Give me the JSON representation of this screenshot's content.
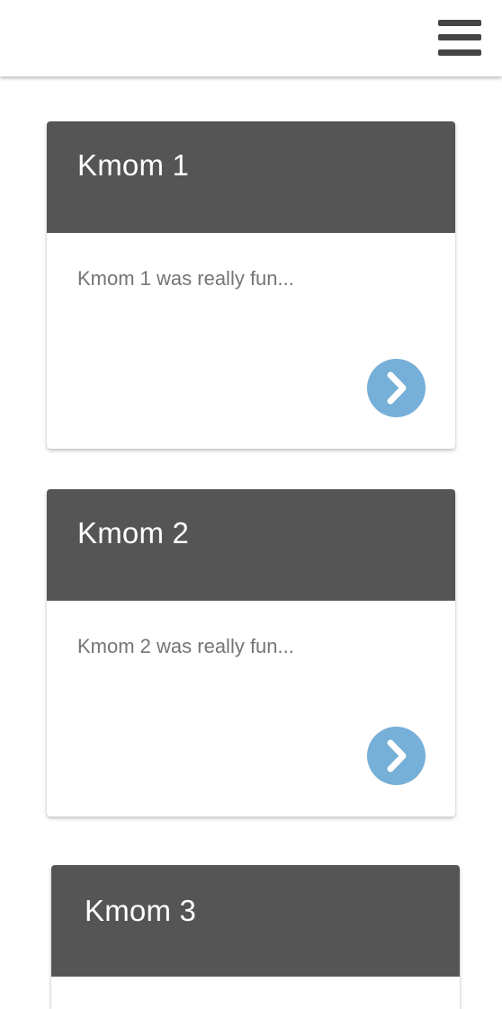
{
  "header": {
    "menu_icon": "hamburger-menu-icon"
  },
  "cards": [
    {
      "title": "Kmom 1",
      "text": "Kmom 1 was really fun...",
      "action_icon": "chevron-right-icon"
    },
    {
      "title": "Kmom 2",
      "text": "Kmom 2 was really fun...",
      "action_icon": "chevron-right-icon"
    },
    {
      "title": "Kmom 3"
    }
  ],
  "colors": {
    "card_header": "#555555",
    "action_button": "#76afd8",
    "menu_icon": "#454545",
    "body_text": "#757575"
  }
}
